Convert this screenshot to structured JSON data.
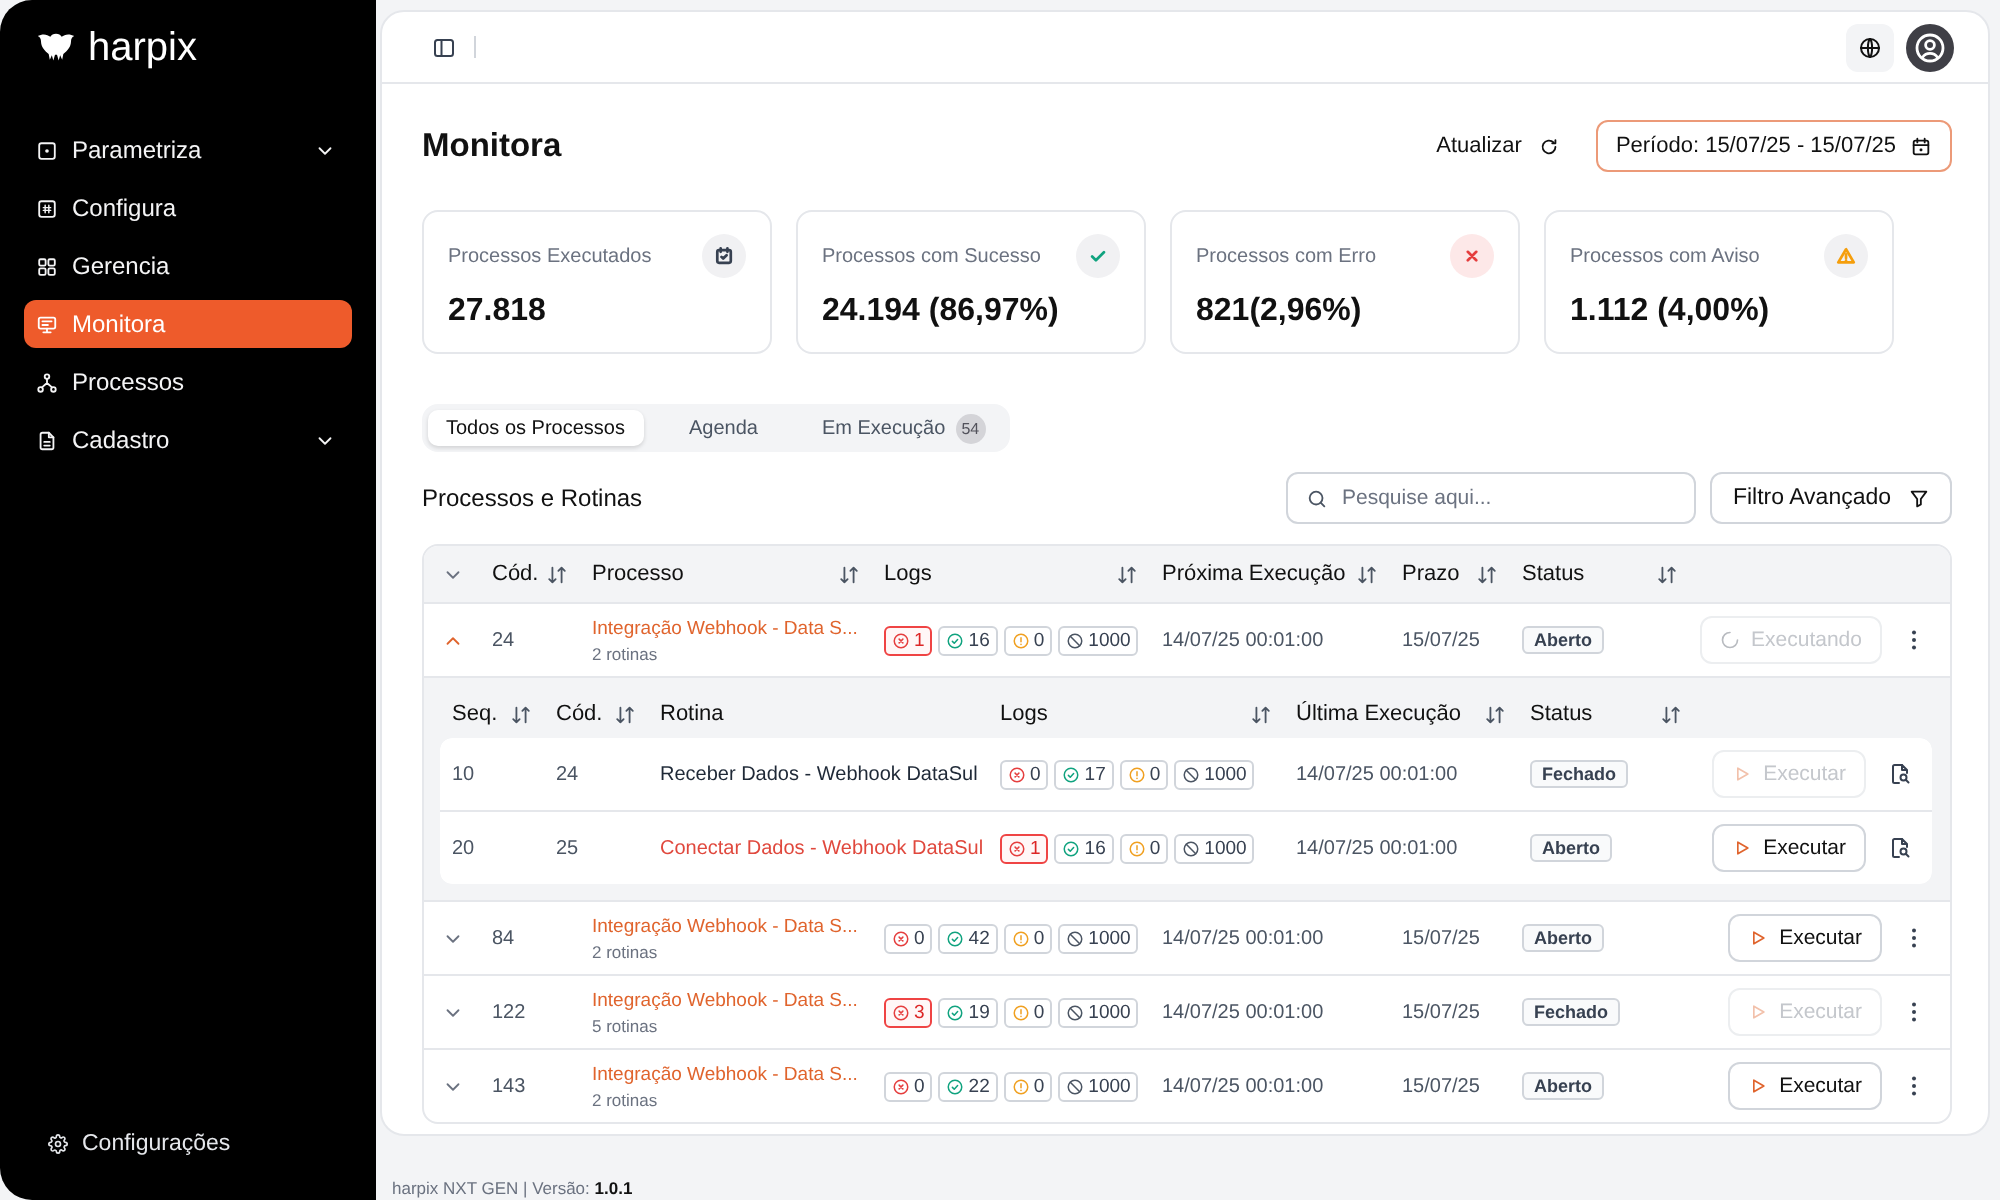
{
  "sidebar": {
    "logo": "harpix",
    "items": [
      {
        "label": "Parametriza",
        "selected": false,
        "expanded": false
      },
      {
        "label": "Configura",
        "selected": false
      },
      {
        "label": "Gerencia",
        "selected": false
      },
      {
        "label": "Monitora",
        "selected": true
      },
      {
        "label": "Processos",
        "selected": false
      },
      {
        "label": "Cadastro",
        "selected": false,
        "expanded": false
      }
    ],
    "settings": "Configurações"
  },
  "page_header": {
    "title": "Monitora",
    "refresh_button": "Atualizar",
    "period_button": "Período: 15/07/25 - 15/07/25"
  },
  "cards": [
    {
      "kind": "total",
      "label": "Processos Executados",
      "value": "27.818"
    },
    {
      "kind": "success",
      "label": "Processos com Sucesso",
      "value": "24.194 (86,97%)"
    },
    {
      "kind": "error",
      "label": "Processos com Erro",
      "value": "821(2,96%)"
    },
    {
      "kind": "warning",
      "label": "Processos com Aviso",
      "value": "1.112 (4,00%)"
    }
  ],
  "tabs": [
    {
      "label": "Todos os Processos",
      "selected": true
    },
    {
      "label": "Agenda",
      "selected": false
    },
    {
      "label": "Em Execução",
      "selected": false,
      "badge": "54"
    }
  ],
  "section": {
    "title": "Processos e Rotinas",
    "search": {
      "placeholder": "Pesquise aqui..."
    },
    "filter_button": "Filtro Avançado"
  },
  "table": {
    "columns": [
      {
        "label": "Cód.",
        "sortable": true
      },
      {
        "label": "Processo",
        "sortable": true
      },
      {
        "label": "Logs",
        "sortable": true
      },
      {
        "label": "Próxima Execução",
        "sortable": true
      },
      {
        "label": "Prazo",
        "sortable": true
      },
      {
        "label": "Status",
        "sortable": true
      }
    ],
    "rows": [
      {
        "expanded": true,
        "code": "24",
        "name": "Integração Webhook - Data S...",
        "routines": "2 rotinas",
        "logs": [
          {
            "kind": "error",
            "count": "1",
            "flagged": true
          },
          {
            "kind": "success",
            "count": "16",
            "flagged": false
          },
          {
            "kind": "warning",
            "count": "0",
            "flagged": false
          },
          {
            "kind": "blocked",
            "count": "1000",
            "flagged": false
          }
        ],
        "next_run": "14/07/25 00:01:00",
        "deadline": "15/07/25",
        "status": "Aberto",
        "action": {
          "kind": "running",
          "label": "Executando",
          "disabled": true
        },
        "subtable": {
          "columns": [
            {
              "label": "Seq.",
              "sortable": true
            },
            {
              "label": "Cód.",
              "sortable": true
            },
            {
              "label": "Rotina",
              "sortable": false
            },
            {
              "label": "Logs",
              "sortable": true
            },
            {
              "label": "Última Execução",
              "sortable": true
            },
            {
              "label": "Status",
              "sortable": true
            }
          ],
          "rows": [
            {
              "seq": "10",
              "code": "24",
              "name": "Receber Dados - Webhook DataSul",
              "has_error": false,
              "logs": [
                {
                  "kind": "error",
                  "count": "0",
                  "flagged": false
                },
                {
                  "kind": "success",
                  "count": "17",
                  "flagged": false
                },
                {
                  "kind": "warning",
                  "count": "0",
                  "flagged": false
                },
                {
                  "kind": "blocked",
                  "count": "1000",
                  "flagged": false
                }
              ],
              "last_run": "14/07/25 00:01:00",
              "status": "Fechado",
              "action": {
                "kind": "run",
                "label": "Executar",
                "disabled": true
              }
            },
            {
              "seq": "20",
              "code": "25",
              "name": "Conectar Dados - Webhook DataSul",
              "has_error": true,
              "logs": [
                {
                  "kind": "error",
                  "count": "1",
                  "flagged": true
                },
                {
                  "kind": "success",
                  "count": "16",
                  "flagged": false
                },
                {
                  "kind": "warning",
                  "count": "0",
                  "flagged": false
                },
                {
                  "kind": "blocked",
                  "count": "1000",
                  "flagged": false
                }
              ],
              "last_run": "14/07/25 00:01:00",
              "status": "Aberto",
              "action": {
                "kind": "run",
                "label": "Executar",
                "disabled": false
              }
            }
          ]
        }
      },
      {
        "expanded": false,
        "code": "84",
        "name": "Integração Webhook - Data S...",
        "routines": "2 rotinas",
        "logs": [
          {
            "kind": "error",
            "count": "0",
            "flagged": false
          },
          {
            "kind": "success",
            "count": "42",
            "flagged": false
          },
          {
            "kind": "warning",
            "count": "0",
            "flagged": false
          },
          {
            "kind": "blocked",
            "count": "1000",
            "flagged": false
          }
        ],
        "next_run": "14/07/25 00:01:00",
        "deadline": "15/07/25",
        "status": "Aberto",
        "action": {
          "kind": "run",
          "label": "Executar",
          "disabled": false
        }
      },
      {
        "expanded": false,
        "code": "122",
        "name": "Integração Webhook - Data S...",
        "routines": "5 rotinas",
        "logs": [
          {
            "kind": "error",
            "count": "3",
            "flagged": true
          },
          {
            "kind": "success",
            "count": "19",
            "flagged": false
          },
          {
            "kind": "warning",
            "count": "0",
            "flagged": false
          },
          {
            "kind": "blocked",
            "count": "1000",
            "flagged": false
          }
        ],
        "next_run": "14/07/25 00:01:00",
        "deadline": "15/07/25",
        "status": "Fechado",
        "action": {
          "kind": "run",
          "label": "Executar",
          "disabled": true
        }
      },
      {
        "expanded": false,
        "code": "143",
        "name": "Integração Webhook - Data S...",
        "routines": "2 rotinas",
        "logs": [
          {
            "kind": "error",
            "count": "0",
            "flagged": false
          },
          {
            "kind": "success",
            "count": "22",
            "flagged": false
          },
          {
            "kind": "warning",
            "count": "0",
            "flagged": false
          },
          {
            "kind": "blocked",
            "count": "1000",
            "flagged": false
          }
        ],
        "next_run": "14/07/25 00:01:00",
        "deadline": "15/07/25",
        "status": "Aberto",
        "action": {
          "kind": "run",
          "label": "Executar",
          "disabled": false
        }
      }
    ]
  },
  "footer": "harpix NXT GEN | Versão: **1.0.1**"
}
